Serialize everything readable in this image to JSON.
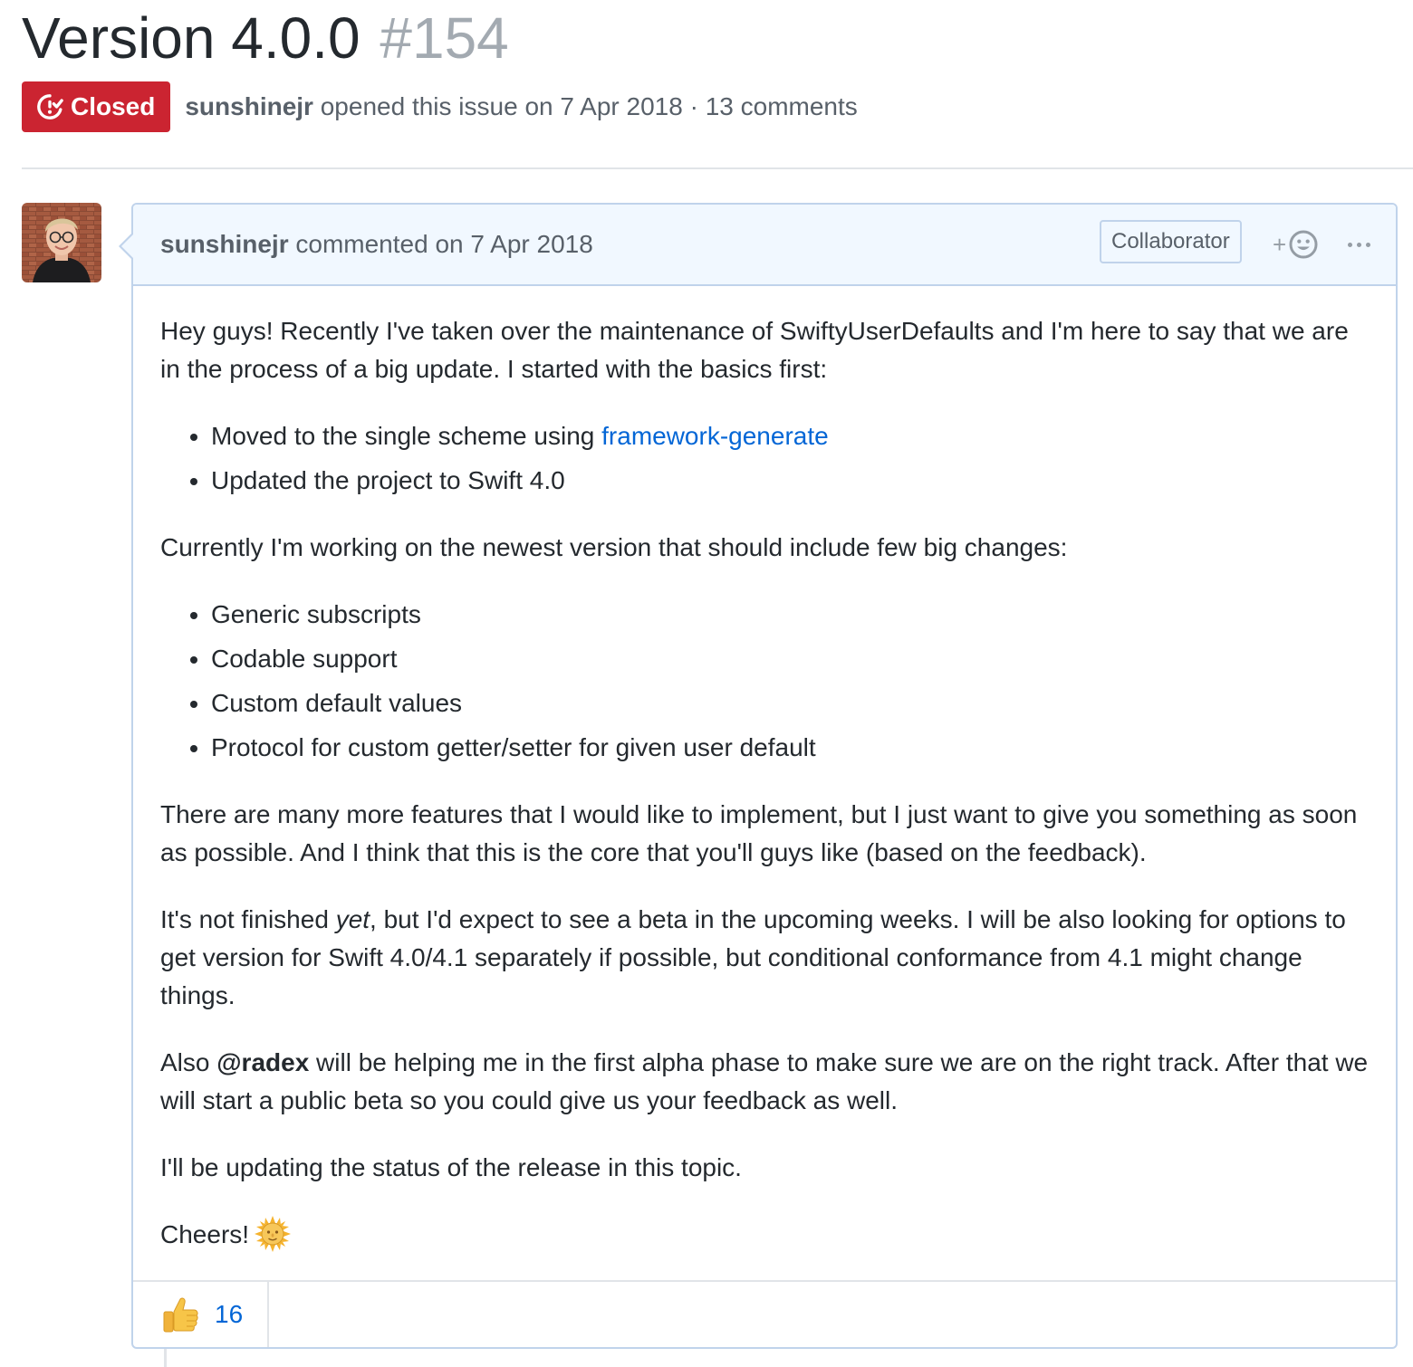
{
  "issue": {
    "title": "Version 4.0.0",
    "number": "#154",
    "state": "Closed",
    "author": "sunshinejr",
    "meta_text": " opened this issue on 7 Apr 2018 · 13 comments"
  },
  "comment": {
    "author": "sunshinejr",
    "timestamp_text": " commented on 7 Apr 2018",
    "role": "Collaborator",
    "add_reaction_label": "+",
    "body": {
      "p1": "Hey guys! Recently I've taken over the maintenance of SwiftyUserDefaults and I'm here to say that we are in the process of a big update. I started with the basics first:",
      "list1": {
        "item1_prefix": "Moved to the single scheme using ",
        "item1_link": "framework-generate",
        "item2": "Updated the project to Swift 4.0"
      },
      "p2": "Currently I'm working on the newest version that should include few big changes:",
      "list2": [
        "Generic subscripts",
        "Codable support",
        "Custom default values",
        "Protocol for custom getter/setter for given user default"
      ],
      "p3": "There are many more features that I would like to implement, but I just want to give you something as soon as possible. And I think that this is the core that you'll guys like (based on the feedback).",
      "p4": {
        "before": "It's not finished ",
        "em": "yet",
        "after": ", but I'd expect to see a beta in the upcoming weeks. I will be also looking for options to get version for Swift 4.0/4.1 separately if possible, but conditional conformance from 4.1 might change things."
      },
      "p5": {
        "before": "Also ",
        "mention": "@radex",
        "after": " will be helping me in the first alpha phase to make sure we are on the right track. After that we will start a public beta so you could give us your feedback as well."
      },
      "p6": "I'll be updating the status of the release in this topic.",
      "p7": "Cheers!"
    },
    "reactions": {
      "thumbs_up_count": "16"
    }
  },
  "icons": {
    "state": "issue-closed-icon",
    "smiley": "smiley-icon",
    "more": "kebab-horizontal-icon",
    "thumbs_up": "thumbs-up-emoji",
    "sun": "sun-with-face-emoji"
  },
  "colors": {
    "closed_badge": "#cb2431",
    "link": "#0366d6",
    "header_bg": "#f1f8ff",
    "header_border": "#c0d3eb"
  }
}
